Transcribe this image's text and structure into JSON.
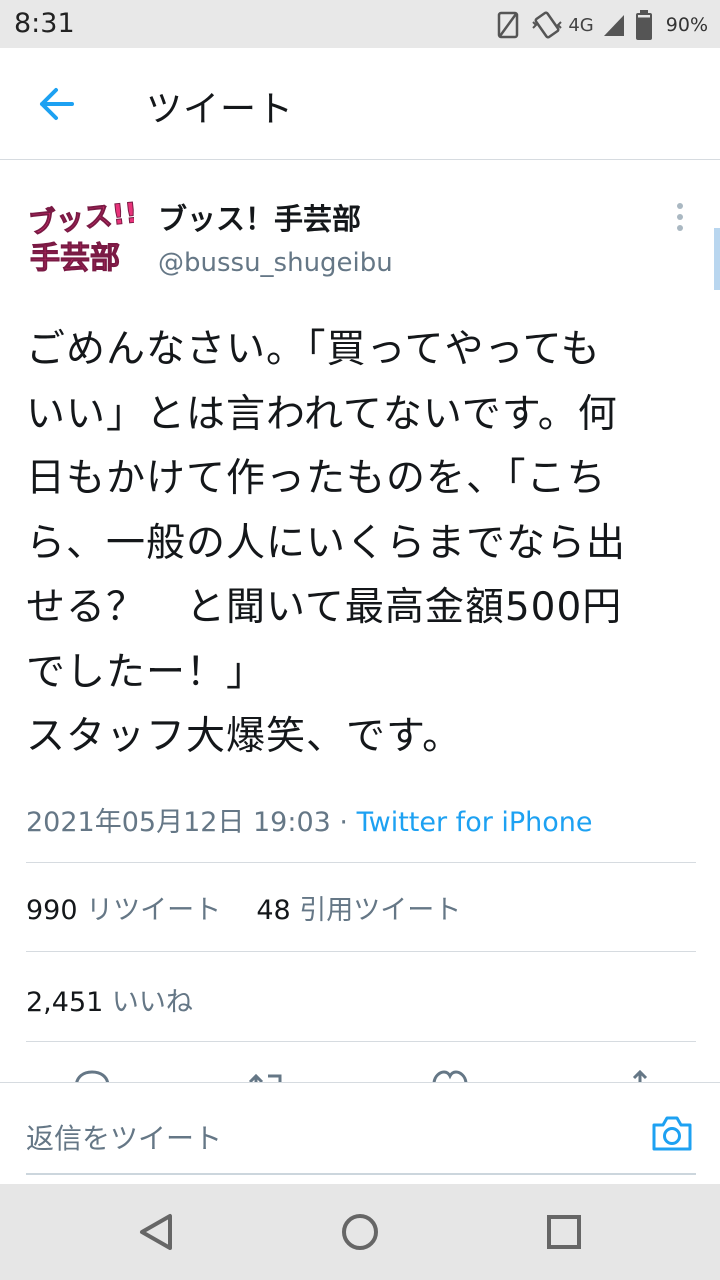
{
  "status": {
    "time": "8:31",
    "network": "4G",
    "battery": "90%"
  },
  "header": {
    "title": "ツイート",
    "back_icon": "arrow-left-icon"
  },
  "tweet": {
    "avatar_text": "ブッス!! 手芸部",
    "display_name": "ブッス！手芸部",
    "username": "@bussu_shugeibu",
    "text": "ごめんなさい。「買ってやっても\nいい」とは言われてないです。何\n日もかけて作ったものを、「こち\nら、一般の人にいくらまでなら出\nせる？　と聞いて最高金額500円\nでしたー！」\nスタッフ大爆笑、です。",
    "timestamp": "2021年05月12日 19:03",
    "separator": "·",
    "source": "Twitter for iPhone"
  },
  "stats": {
    "retweets_count": "990",
    "retweets_label": "リツイート",
    "quotes_count": "48",
    "quotes_label": "引用ツイート",
    "likes_count": "2,451",
    "likes_label": "いいね"
  },
  "reply": {
    "placeholder": "返信をツイート",
    "camera_icon": "camera-icon"
  },
  "colors": {
    "accent": "#1da1f2",
    "secondary_text": "#657786",
    "avatar_pink": "#e8337a"
  }
}
